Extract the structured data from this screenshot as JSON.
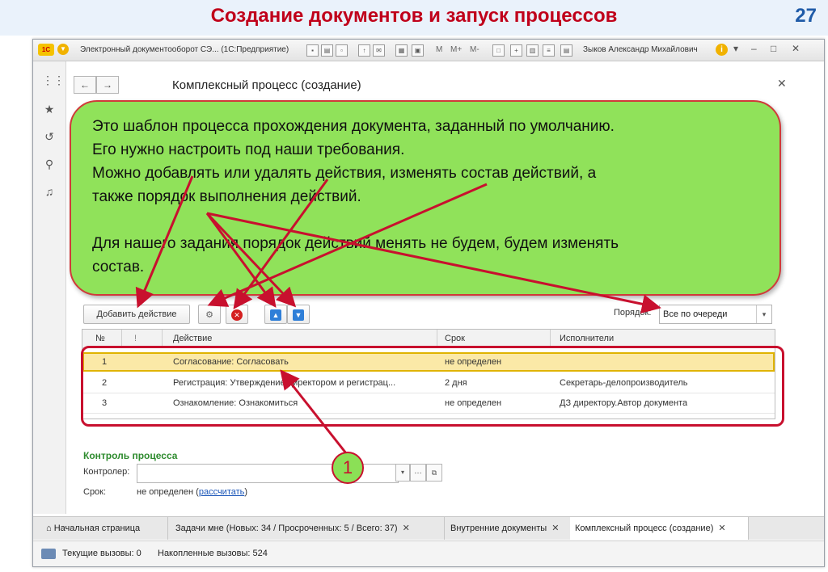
{
  "slide": {
    "title": "Создание документов и запуск процессов",
    "page_number": "27"
  },
  "window": {
    "title": "Электронный документооборот СЭ... (1С:Предприятие)",
    "user": "Зыков Александр Михайлович",
    "mem_buttons": [
      "M",
      "M+",
      "M-"
    ]
  },
  "form": {
    "title": "Комплексный процесс (создание)"
  },
  "toolbar": {
    "add_action_label": "Добавить действие",
    "order_label": "Порядок:",
    "order_value": "Все по очереди"
  },
  "table": {
    "columns": [
      "№",
      "Действие",
      "Срок",
      "Исполнители"
    ],
    "rows": [
      {
        "num": "1",
        "action": "Согласование: Согласовать",
        "term": "не определен",
        "performers": ""
      },
      {
        "num": "2",
        "action": "Регистрация: Утверждение директором и регистрац...",
        "term": "2 дня",
        "performers": "Секретарь-делопроизводитель"
      },
      {
        "num": "3",
        "action": "Ознакомление: Ознакомиться",
        "term": "не определен",
        "performers": "ДЗ директору.Автор документа"
      }
    ]
  },
  "control": {
    "section_title": "Контроль процесса",
    "controller_label": "Контролер:",
    "controller_value": "",
    "term_label": "Срок:",
    "term_value": "не определен (",
    "term_link": "рассчитать",
    "term_close": ")"
  },
  "tabs": [
    {
      "label": "Начальная страница"
    },
    {
      "label": "Задачи мне (Новых: 34 / Просроченных: 5 / Всего: 37)"
    },
    {
      "label": "Внутренние документы"
    },
    {
      "label": "Комплексный процесс (создание)"
    }
  ],
  "status": {
    "current_calls": "Текущие вызовы: 0",
    "accumulated_calls": "Накопленные вызовы: 524"
  },
  "callout": {
    "lines": [
      "Это шаблон процесса прохождения документа, заданный по умолчанию.",
      "Его нужно настроить под наши требования.",
      "Можно добавлять или удалять действия, изменять состав действий, а",
      "также порядок выполнения действий.",
      "Для нашего задания порядок действий менять не будем, будем изменять",
      "состав."
    ]
  },
  "badge": {
    "label": "1"
  },
  "colors": {
    "title_red": "#c0001a",
    "callout_green": "#90e25a",
    "annotation_red": "#c8102e",
    "selected_row": "#fbe9a7",
    "section_green": "#2e8b2e",
    "link_blue": "#1b56b8"
  }
}
